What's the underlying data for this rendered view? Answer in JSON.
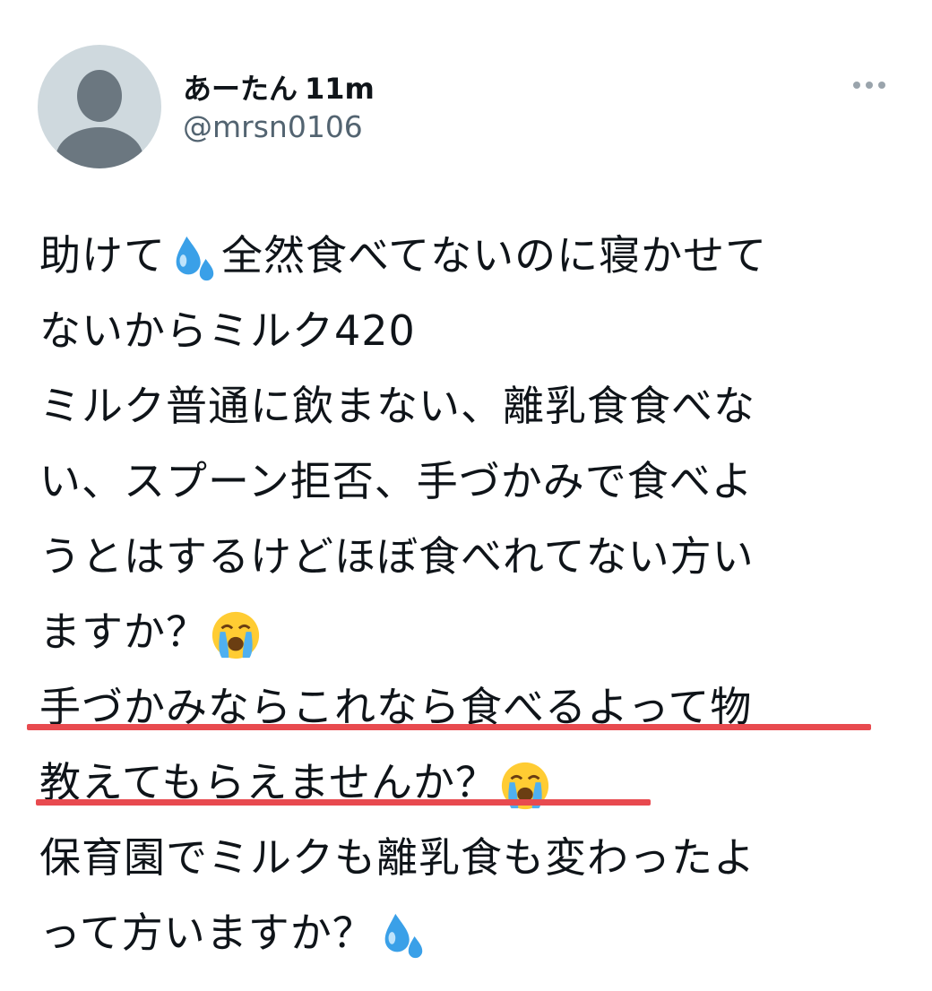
{
  "tweet": {
    "author": {
      "display_name": "あーたん",
      "handle": "@mrsn0106"
    },
    "timestamp": "11m",
    "lines": [
      {
        "parts": [
          "助けて",
          "💦",
          "全然食べてないのに寝かせて"
        ]
      },
      {
        "parts": [
          "ないからミルク420"
        ]
      },
      {
        "parts": [
          "ミルク普通に飲まない、離乳食食べな"
        ]
      },
      {
        "parts": [
          "い、スプーン拒否、手づかみで食べよ"
        ]
      },
      {
        "parts": [
          "うとはするけどほぼ食べれてない方い"
        ]
      },
      {
        "parts": [
          "ますか？",
          "😭"
        ]
      },
      {
        "parts": [
          "手づかみならこれなら食べるよって物"
        ]
      },
      {
        "parts": [
          "教えてもらえませんか？",
          "😭"
        ]
      },
      {
        "parts": [
          "保育園でミルクも離乳食も変わったよ"
        ]
      },
      {
        "parts": [
          "って方いますか？",
          "💦"
        ]
      }
    ]
  },
  "icons": {
    "avatar": "default-avatar-icon",
    "more": "more-options-icon",
    "sweat": "sweat-droplets-emoji",
    "crying": "loudly-crying-face-emoji"
  },
  "colors": {
    "avatar_bg": "#cfd9de",
    "avatar_fg": "#6b7780",
    "underline": "#e84a4f",
    "handle": "#536471"
  }
}
